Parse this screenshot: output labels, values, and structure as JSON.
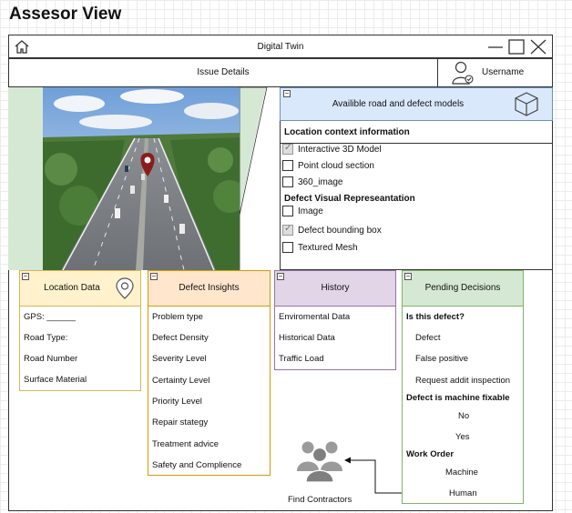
{
  "page_title": "Assesor View",
  "window": {
    "title": "Digital Twin"
  },
  "issue": {
    "title": "Issue Details",
    "username": "Username"
  },
  "models": {
    "title": "Availible road and defect models",
    "location_context": "Location context information",
    "options": [
      {
        "label": "Interactive 3D Model",
        "checked": true
      },
      {
        "label": "Point cloud section",
        "checked": false
      },
      {
        "label": "360_image",
        "checked": false
      }
    ],
    "defect_visual_title": "Defect Visual Represeantation",
    "defect_options": [
      {
        "label": "Image",
        "checked": false
      },
      {
        "label": "Defect bounding box",
        "checked": true
      },
      {
        "label": "Textured Mesh",
        "checked": false
      }
    ]
  },
  "location": {
    "title": "Location Data",
    "items": [
      "GPS: ______",
      "Road Type:",
      "Road Number",
      "Surface Material"
    ]
  },
  "insights": {
    "title": "Defect Insights",
    "items": [
      "Problem type",
      "Defect Density",
      "Severity Level",
      "Certainty Level",
      "Priority Level",
      "Repair stategy",
      "Treatment advice",
      "Safety and Complience"
    ]
  },
  "history": {
    "title": "History",
    "items": [
      "Enviromental Data",
      "Historical Data",
      "Traffic Load"
    ]
  },
  "pending": {
    "title": "Pending Decisions",
    "q1": "Is this defect?",
    "q1_options": [
      "Defect",
      "False positive",
      "Request addit inspection"
    ],
    "q2": "Defect is machine fixable",
    "q2_options": [
      "No",
      "Yes"
    ],
    "q3": "Work Order",
    "q3_options": [
      "Machine",
      "Human"
    ]
  },
  "find_contractors": "Find Contractors",
  "colors": {
    "models_head": "#dae8fc",
    "location_head": "#fff2cc",
    "insights_head": "#ffe6cc",
    "history_head": "#e1d5e7",
    "pending_head": "#d5e8d4",
    "viewer_bg": "#d5e8d4"
  }
}
